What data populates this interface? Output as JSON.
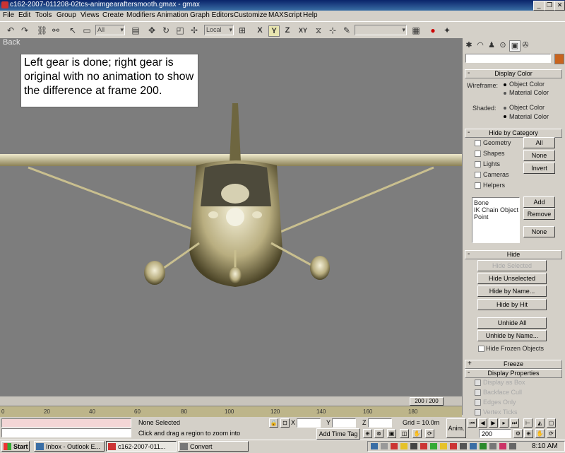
{
  "window": {
    "title": "c162-2007-011208-02tcs-animgearaftersmooth.gmax - gmax"
  },
  "menu": [
    "File",
    "Edit",
    "Tools",
    "Group",
    "Views",
    "Create",
    "Modifiers",
    "Animation",
    "Graph Editors",
    "Customize",
    "MAXScript",
    "Help"
  ],
  "toolbar": {
    "selection_filter": "All",
    "coord_system": "Local",
    "constraints": [
      "X",
      "Y",
      "Z",
      "XY"
    ]
  },
  "viewport": {
    "label": "Back",
    "note": "Left gear is done; right gear is original with no animation to show the difference at frame 200."
  },
  "panel": {
    "display_color": {
      "title": "Display Color",
      "wireframe_label": "Wireframe:",
      "shaded_label": "Shaded:",
      "option_object": "Object Color",
      "option_material": "Material Color"
    },
    "hide_by_category": {
      "title": "Hide by Category",
      "items": [
        "Geometry",
        "Shapes",
        "Lights",
        "Cameras",
        "Helpers"
      ],
      "all": "All",
      "none": "None",
      "invert": "Invert",
      "list": [
        "Bone",
        "IK Chain Object",
        "Point"
      ],
      "add": "Add",
      "remove": "Remove",
      "none2": "None"
    },
    "hide": {
      "title": "Hide",
      "hide_selected": "Hide Selected",
      "hide_unselected": "Hide Unselected",
      "hide_by_name": "Hide by Name...",
      "hide_by_hit": "Hide by Hit",
      "unhide_all": "Unhide All",
      "unhide_by_name": "Unhide by Name...",
      "hide_frozen": "Hide Frozen Objects"
    },
    "freeze": {
      "title": "Freeze"
    },
    "display_properties": {
      "title": "Display Properties",
      "items": [
        "Display as Box",
        "Backface Cull",
        "Edges Only",
        "Vertex Ticks"
      ]
    }
  },
  "timeline": {
    "frame_readout": "200 / 200",
    "current_frame": 200,
    "total_frames": 200,
    "ticks": [
      "0",
      "20",
      "40",
      "60",
      "80",
      "100",
      "120",
      "140",
      "160",
      "180"
    ]
  },
  "status": {
    "selection": "None Selected",
    "prompt": "Click and drag a region to zoom into",
    "x_label": "X",
    "y_label": "Y",
    "z_label": "Z",
    "grid": "Grid = 10.0m",
    "add_time_tag": "Add Time Tag",
    "anim": "Anim.",
    "frame": "200"
  },
  "taskbar": {
    "start": "Start",
    "tasks": [
      "Inbox - Outlook E...",
      "c162-2007-011...",
      "Convert"
    ],
    "clock": "8:10 AM"
  },
  "colors": {
    "viewport_bg": "#7d7d7d",
    "aircraft": "#c9bf8f",
    "title_bar": "#0a246a",
    "rollout_blue": "#3a6ea5"
  }
}
